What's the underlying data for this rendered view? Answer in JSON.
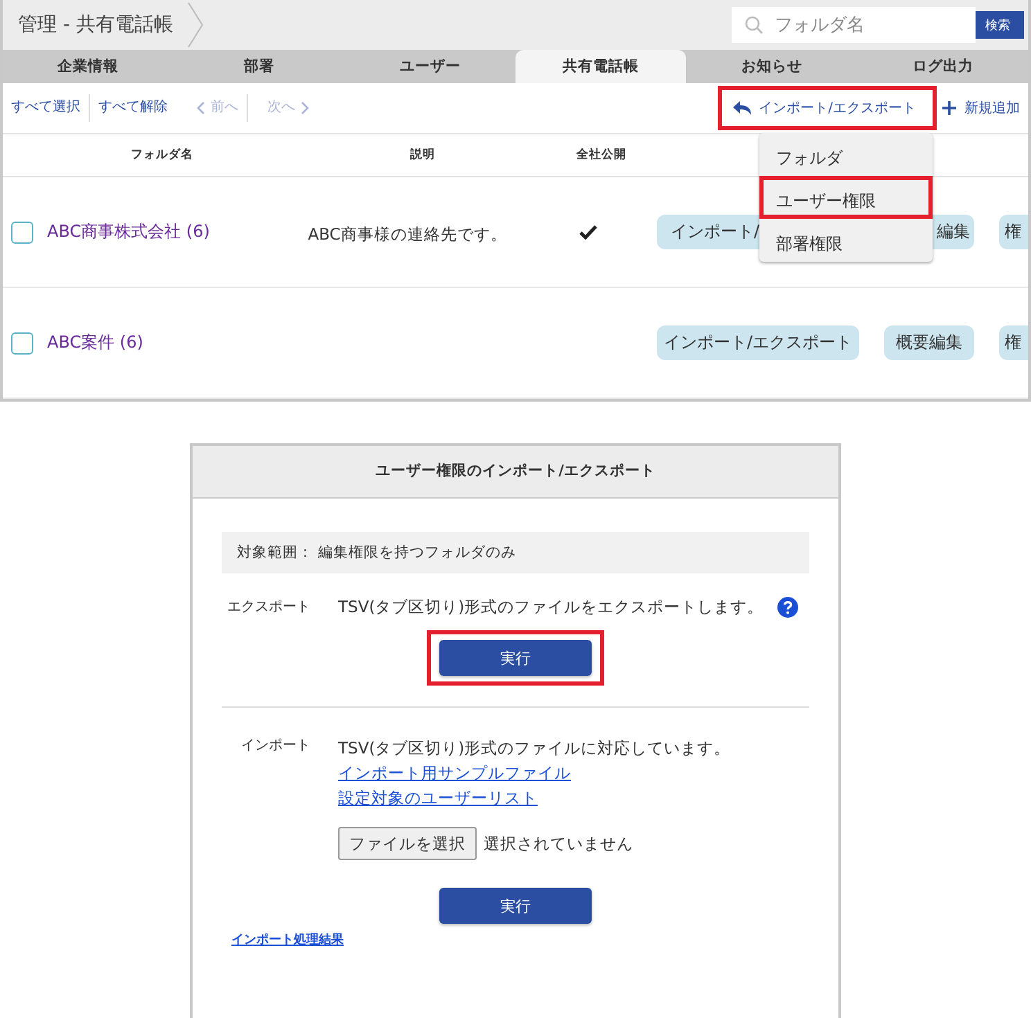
{
  "header": {
    "breadcrumb": "管理 - 共有電話帳",
    "search": {
      "placeholder": "フォルダ名",
      "button": "検索"
    }
  },
  "tabs": [
    {
      "label": "企業情報",
      "selected": false
    },
    {
      "label": "部署",
      "selected": false
    },
    {
      "label": "ユーザー",
      "selected": false
    },
    {
      "label": "共有電話帳",
      "selected": true
    },
    {
      "label": "お知らせ",
      "selected": false
    },
    {
      "label": "ログ出力",
      "selected": false
    }
  ],
  "toolbar": {
    "left": [
      {
        "kind": "text",
        "label": "すべて選択",
        "disabled": false
      },
      {
        "kind": "text",
        "label": "すべて解除",
        "disabled": false
      },
      {
        "kind": "prev",
        "label": "前へ",
        "disabled": true
      },
      {
        "kind": "next",
        "label": "次へ",
        "disabled": true
      }
    ],
    "import_export": {
      "label": "インポート/エクスポート",
      "highlighted": true
    },
    "add": {
      "label": "新規追加"
    }
  },
  "table": {
    "columns": [
      "フォルダ名",
      "説明",
      "全社公開"
    ],
    "rows": [
      {
        "checked": false,
        "name": "ABC商事株式会社 (6)",
        "description": "ABC商事様の連絡先です。",
        "public": true,
        "actions": [
          "インポート/",
          "編集",
          "権"
        ]
      },
      {
        "checked": false,
        "name": "ABC案件 (6)",
        "actions": [
          "インポート/エクスポート",
          "概要編集",
          "権"
        ]
      }
    ]
  },
  "menu": {
    "items": [
      {
        "label": "フォルダ",
        "highlighted": false
      },
      {
        "label": "ユーザー権限",
        "highlighted": true
      },
      {
        "label": "部署権限",
        "highlighted": false
      }
    ]
  },
  "dialog": {
    "title": "ユーザー権限のインポート/エクスポート",
    "scope": "対象範囲： 編集権限を持つフォルダのみ",
    "export": {
      "label": "エクスポート",
      "text": "TSV(タブ区切り)形式のファイルをエクスポートします。",
      "button": "実行",
      "highlighted": true
    },
    "import": {
      "label": "インポート",
      "text": "TSV(タブ区切り)形式のファイルに対応しています。",
      "links": [
        "インポート用サンプルファイル",
        "設定対象のユーザーリスト"
      ],
      "file_button": "ファイルを選択",
      "file_status": "選択されていません",
      "button": "実行",
      "highlighted": false
    },
    "result_link": "インポート処理結果"
  }
}
